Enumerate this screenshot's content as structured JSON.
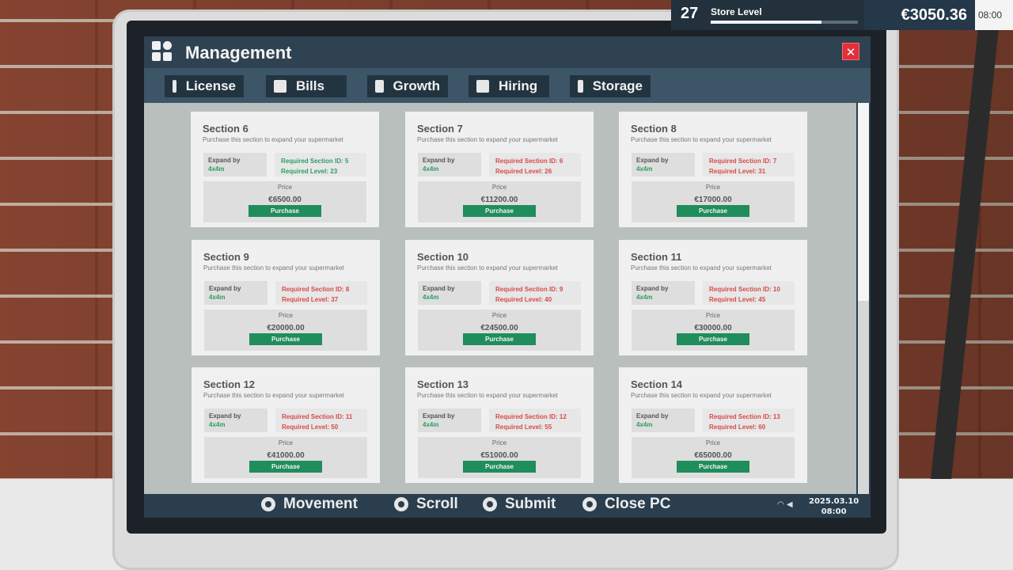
{
  "hud": {
    "store_level_number": "27",
    "store_level_label": "Store Level",
    "level_progress": 0.75,
    "money": "€3050.36",
    "time": "08:00"
  },
  "window": {
    "title": "Management",
    "close_symbol": "✕"
  },
  "tabs": [
    {
      "label": "License",
      "icon": "license-icon"
    },
    {
      "label": "Bills",
      "icon": "bills-icon"
    },
    {
      "label": "Growth",
      "icon": "growth-icon"
    },
    {
      "label": "Hiring",
      "icon": "hiring-icon"
    },
    {
      "label": "Storage",
      "icon": "storage-icon"
    }
  ],
  "sections": [
    {
      "title": "Section 6",
      "subtitle": "Purchase this section to expand your supermarket",
      "expand_label": "Expand by",
      "expand_size": "4x4m",
      "req_id": "Required Section ID: 5",
      "req_level": "Required Level: 23",
      "req_met": true,
      "price_label": "Price",
      "price": "€6500.00",
      "button": "Purchase"
    },
    {
      "title": "Section 7",
      "subtitle": "Purchase this section to expand your supermarket",
      "expand_label": "Expand by",
      "expand_size": "4x4m",
      "req_id": "Required Section ID: 6",
      "req_level": "Required Level: 26",
      "req_met": false,
      "price_label": "Price",
      "price": "€11200.00",
      "button": "Purchase"
    },
    {
      "title": "Section 8",
      "subtitle": "Purchase this section to expand your supermarket",
      "expand_label": "Expand by",
      "expand_size": "4x4m",
      "req_id": "Required Section ID: 7",
      "req_level": "Required Level: 31",
      "req_met": false,
      "price_label": "Price",
      "price": "€17000.00",
      "button": "Purchase"
    },
    {
      "title": "Section 9",
      "subtitle": "Purchase this section to expand your supermarket",
      "expand_label": "Expand by",
      "expand_size": "4x4m",
      "req_id": "Required Section ID: 8",
      "req_level": "Required Level: 37",
      "req_met": false,
      "price_label": "Price",
      "price": "€20000.00",
      "button": "Purchase"
    },
    {
      "title": "Section 10",
      "subtitle": "Purchase this section to expand your supermarket",
      "expand_label": "Expand by",
      "expand_size": "4x4m",
      "req_id": "Required Section ID: 9",
      "req_level": "Required Level: 40",
      "req_met": false,
      "price_label": "Price",
      "price": "€24500.00",
      "button": "Purchase"
    },
    {
      "title": "Section 11",
      "subtitle": "Purchase this section to expand your supermarket",
      "expand_label": "Expand by",
      "expand_size": "4x4m",
      "req_id": "Required Section ID: 10",
      "req_level": "Required Level: 45",
      "req_met": false,
      "price_label": "Price",
      "price": "€30000.00",
      "button": "Purchase"
    },
    {
      "title": "Section 12",
      "subtitle": "Purchase this section to expand your supermarket",
      "expand_label": "Expand by",
      "expand_size": "4x4m",
      "req_id": "Required Section ID: 11",
      "req_level": "Required Level: 50",
      "req_met": false,
      "price_label": "Price",
      "price": "€41000.00",
      "button": "Purchase"
    },
    {
      "title": "Section 13",
      "subtitle": "Purchase this section to expand your supermarket",
      "expand_label": "Expand by",
      "expand_size": "4x4m",
      "req_id": "Required Section ID: 12",
      "req_level": "Required Level: 55",
      "req_met": false,
      "price_label": "Price",
      "price": "€51000.00",
      "button": "Purchase"
    },
    {
      "title": "Section 14",
      "subtitle": "Purchase this section to expand your supermarket",
      "expand_label": "Expand by",
      "expand_size": "4x4m",
      "req_id": "Required Section ID: 13",
      "req_level": "Required Level: 60",
      "req_met": false,
      "price_label": "Price",
      "price": "€65000.00",
      "button": "Purchase"
    }
  ],
  "controls": [
    {
      "label": "Movement",
      "icon": "left-stick-icon"
    },
    {
      "label": "Scroll",
      "icon": "right-stick-icon"
    },
    {
      "label": "Submit",
      "icon": "cross-button-icon"
    },
    {
      "label": "Close PC",
      "icon": "circle-button-icon"
    }
  ],
  "taskbar": {
    "date": "2025.03.10",
    "time": "08:00"
  },
  "colors": {
    "accent_green": "#1f8d5c",
    "requirement_met": "#2e9e63",
    "requirement_unmet": "#d84a4a",
    "close_red": "#e0303a"
  }
}
